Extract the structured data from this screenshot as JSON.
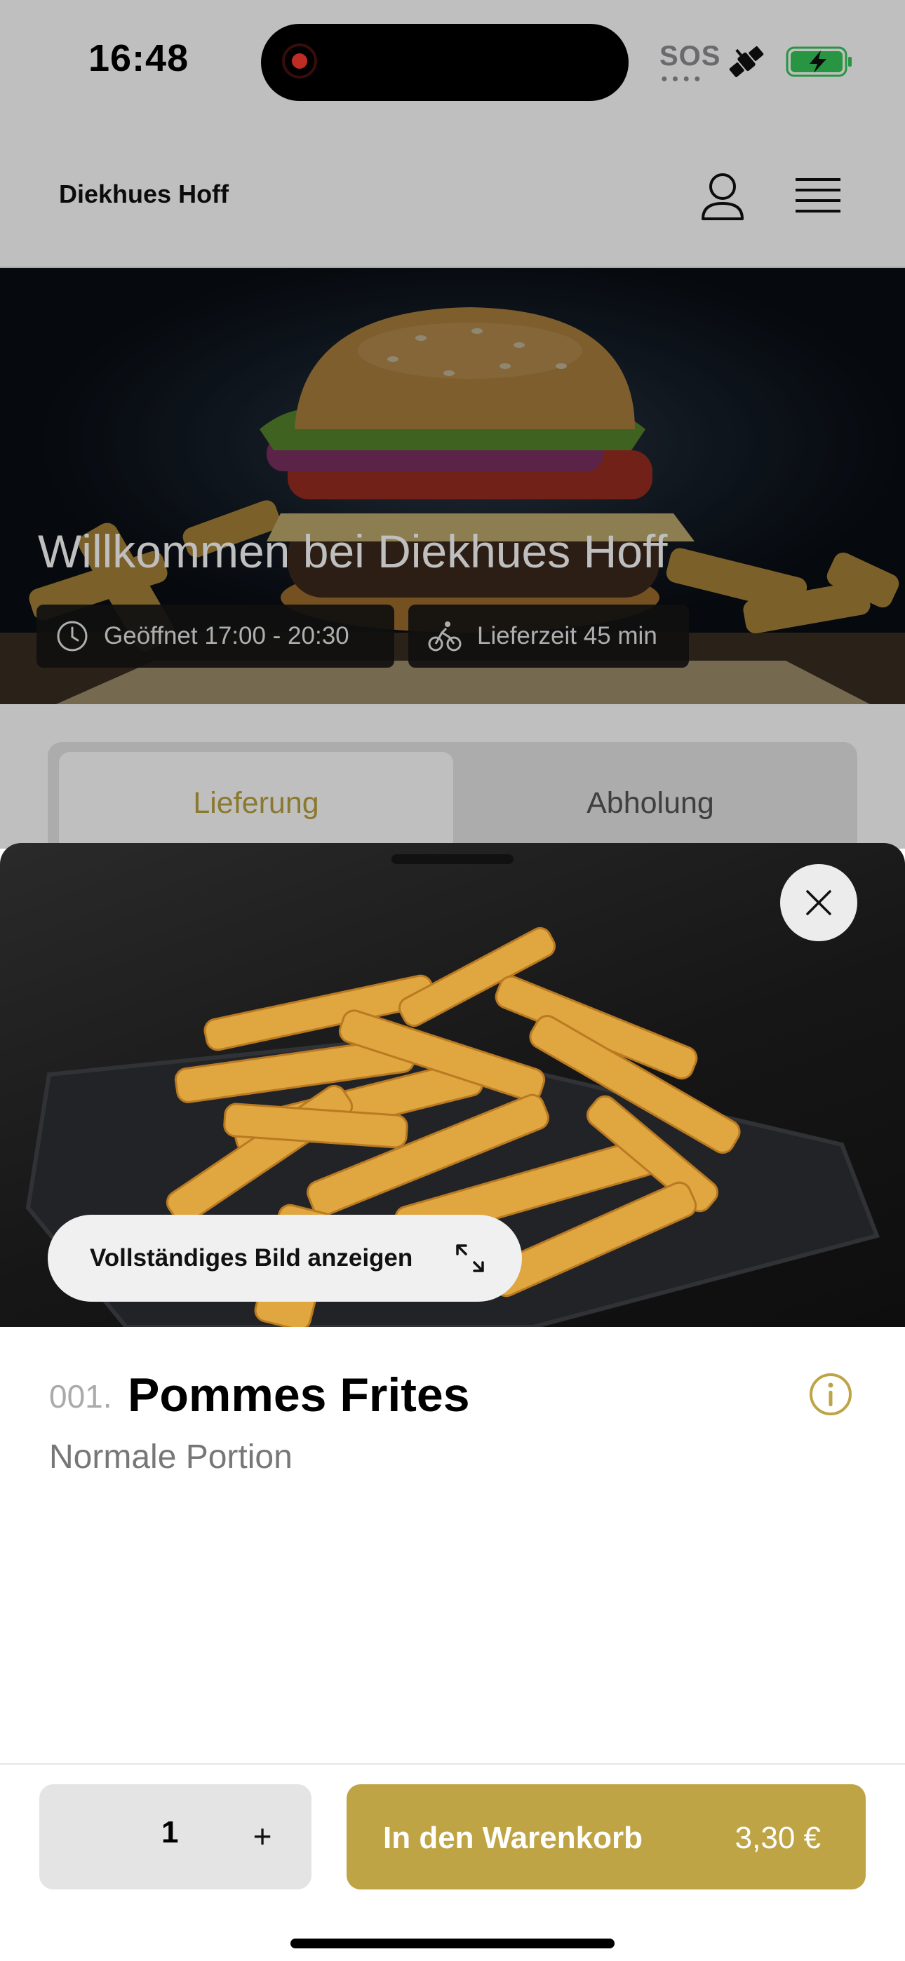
{
  "status_bar": {
    "time": "16:48",
    "sos": "SOS",
    "icons": [
      "recording-indicator",
      "satellite-icon",
      "battery-charging-icon"
    ]
  },
  "header": {
    "brand": "Diekhues Hoff",
    "icons": [
      "user-icon",
      "menu-icon"
    ]
  },
  "hero": {
    "title": "Willkommen bei Diekhues Hoff",
    "opening": "Geöffnet 17:00 - 20:30",
    "delivery_time": "Lieferzeit 45 min",
    "icons": [
      "clock-icon",
      "bicycle-icon"
    ]
  },
  "tabs": [
    {
      "label": "Lieferung",
      "active": true
    },
    {
      "label": "Abholung",
      "active": false
    }
  ],
  "product": {
    "number": "001.",
    "name": "Pommes Frites",
    "description": "Normale Portion",
    "full_image_label": "Vollständiges Bild anzeigen",
    "quantity": "1",
    "plus": "+",
    "add_to_cart": "In den Warenkorb",
    "price": "3,30 €"
  },
  "colors": {
    "accent": "#bfa445",
    "tab_active_text": "#b8a23f",
    "dark_badge": "#161616"
  }
}
